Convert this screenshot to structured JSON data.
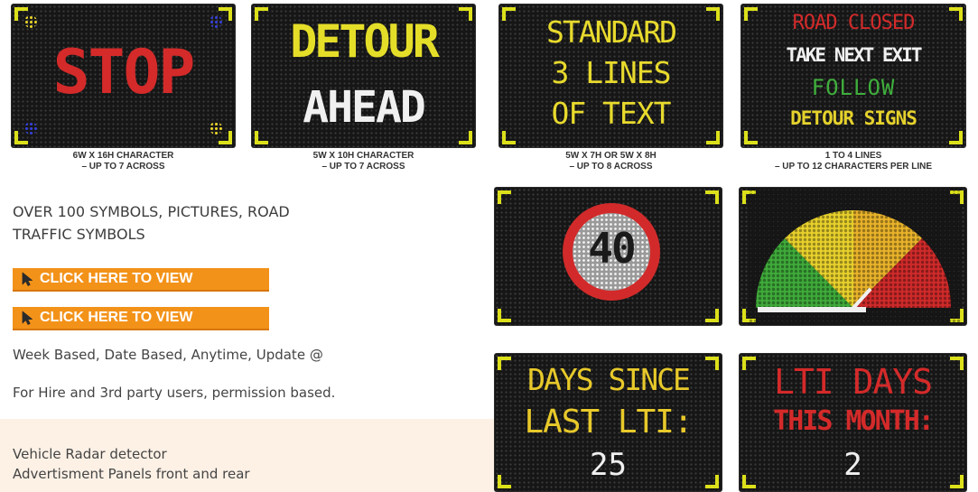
{
  "signs": [
    {
      "lines": [
        "STOP"
      ],
      "colors": [
        "#d42a2a"
      ]
    },
    {
      "lines": [
        "DETOUR",
        "AHEAD"
      ],
      "colors": [
        "#e5de29",
        "#f0f0f0"
      ]
    },
    {
      "lines": [
        "STANDARD",
        "3 LINES",
        "OF TEXT"
      ],
      "colors": [
        "#e8da2d",
        "#e8da2d",
        "#e8da2d"
      ]
    },
    {
      "lines": [
        "ROAD CLOSED",
        "TAKE NEXT EXIT",
        "FOLLOW",
        "DETOUR SIGNS"
      ],
      "colors": [
        "#d42a2a",
        "#f0f0f0",
        "#3fae3c",
        "#e5d22c"
      ]
    },
    {
      "lines": [
        "40"
      ],
      "colors": [
        "#f0f0f0"
      ]
    },
    {
      "lines": [],
      "colors": []
    },
    {
      "lines": [
        "DAYS SINCE",
        "LAST LTI:",
        "25"
      ],
      "colors": [
        "#e8c92a",
        "#e8c92a",
        "#f0f0f0"
      ]
    },
    {
      "lines": [
        "LTI DAYS",
        "THIS MONTH:",
        "2"
      ],
      "colors": [
        "#d42a2a",
        "#d42a2a",
        "#f0f0f0"
      ]
    }
  ],
  "captions": [
    [
      "6W X 16H CHARACTER",
      "– UP TO 7 ACROSS"
    ],
    [
      "5W X 10H CHARACTER",
      "– UP TO 7 ACROSS"
    ],
    [
      "5W X 7H OR 5W X 8H",
      "– UP TO 8 ACROSS"
    ],
    [
      "1 TO 4 LINES",
      "– UP TO 12 CHARACTERS PER LINE"
    ]
  ],
  "symbols_heading": "OVER 100 SYMBOLS, PICTURES, ROAD TRAFFIC SYMBOLS",
  "buttons": [
    "CLICK HERE TO VIEW",
    "CLICK HERE TO VIEW"
  ],
  "scheduling_text": "Week Based, Date Based, Anytime, Update @",
  "access_text": "For Hire and 3rd party users, permission based.",
  "extras": [
    "Vehicle Radar detector",
    "Advertisment Panels front and rear"
  ],
  "colors": {
    "accent": "#f39219",
    "sign_bg": "#161616",
    "corner": "#dce01a",
    "band": "#fdf1e6"
  }
}
